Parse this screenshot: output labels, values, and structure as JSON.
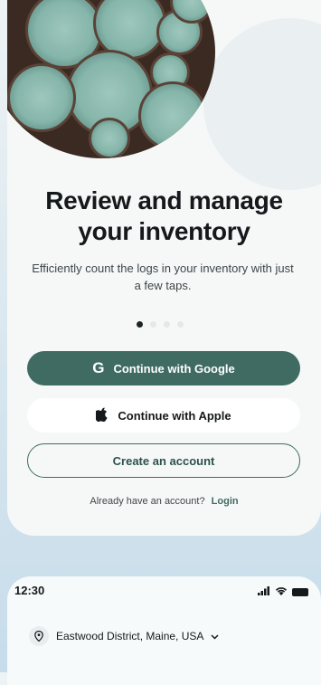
{
  "onboarding": {
    "title_line1": "Review and manage",
    "title_line2": "your inventory",
    "subtitle": "Efficiently count the logs in your inventory with just a few taps.",
    "page_count": 4,
    "active_page": 1
  },
  "buttons": {
    "google_label": "Continue with Google",
    "apple_label": "Continue with Apple",
    "create_label": "Create an account"
  },
  "login": {
    "prompt": "Already have an account?",
    "link": "Login"
  },
  "status_bar": {
    "time": "12:30"
  },
  "location": {
    "label": "Eastwood District, Maine, USA"
  },
  "colors": {
    "accent": "#3f6b63",
    "text": "#15191b",
    "background": "#f6f8f8"
  }
}
